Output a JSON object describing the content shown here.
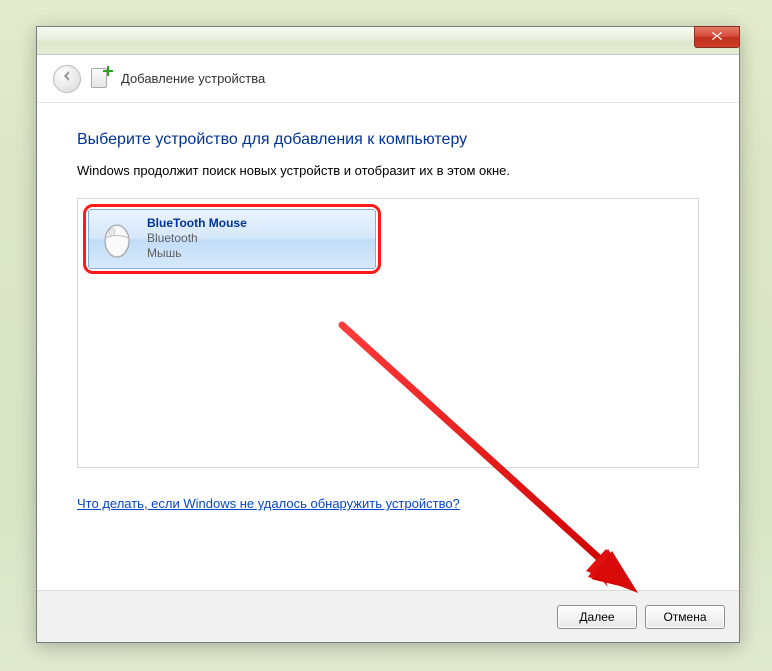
{
  "header": {
    "title": "Добавление устройства"
  },
  "content": {
    "heading": "Выберите устройство для добавления к компьютеру",
    "subtext": "Windows продолжит поиск новых устройств и отобразит их в этом окне.",
    "help_link": "Что делать, если Windows не удалось обнаружить устройство?"
  },
  "device": {
    "name": "BlueTooth Mouse",
    "tech": "Bluetooth",
    "type": "Мышь"
  },
  "footer": {
    "next": "Далее",
    "cancel": "Отмена"
  }
}
